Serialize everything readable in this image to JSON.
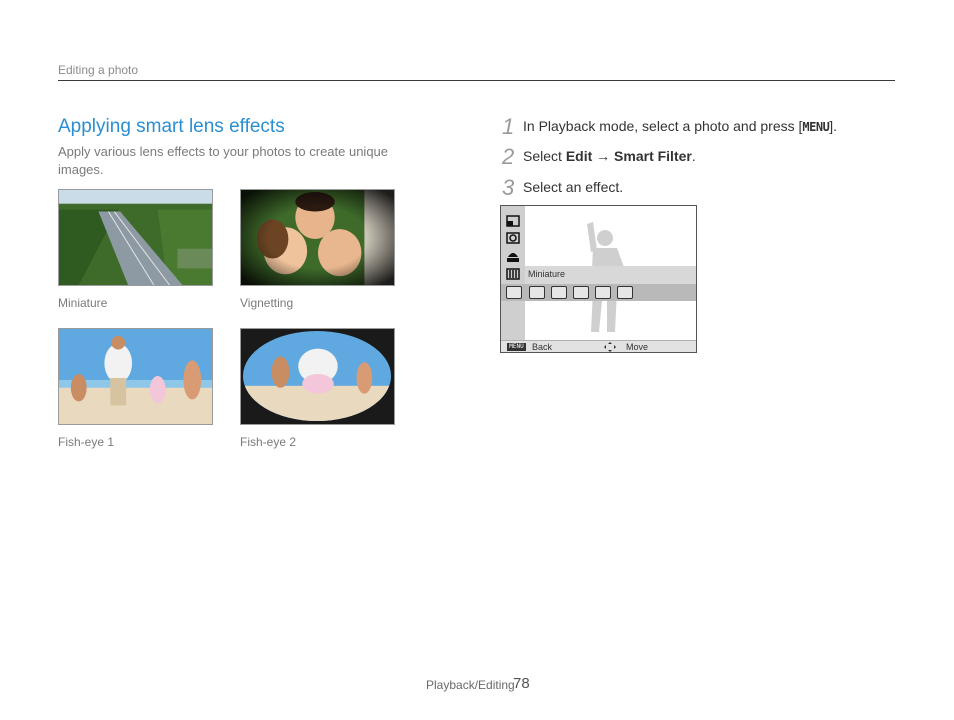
{
  "header": {
    "section": "Editing a photo"
  },
  "section": {
    "title": "Applying smart lens effects",
    "description": "Apply various lens effects to your photos to create unique images."
  },
  "examples": [
    {
      "caption": "Miniature"
    },
    {
      "caption": "Vignetting"
    },
    {
      "caption": "Fish-eye 1"
    },
    {
      "caption": "Fish-eye 2"
    }
  ],
  "steps": [
    {
      "num": "1",
      "before": "In Playback mode, select a photo and press [",
      "key": "MENU",
      "after": "]."
    },
    {
      "num": "2",
      "before": "Select ",
      "edit": "Edit",
      "arrow": " → ",
      "filter": "Smart Filter",
      "after": "."
    },
    {
      "num": "3",
      "text": "Select an effect."
    }
  ],
  "camera_screen": {
    "highlight_label": "Miniature",
    "menu_key": "MENU",
    "back_label": "Back",
    "move_label": "Move",
    "sidebar_icons": [
      "retouch-icon",
      "smart-filter-icon",
      "photo-style-icon",
      "miniature-icon"
    ],
    "effect_icons": [
      "effect-off-icon",
      "effect-off-2-icon",
      "miniature-effect-icon",
      "vignetting-icon",
      "fisheye-1-icon",
      "fisheye-2-icon"
    ]
  },
  "footer": {
    "section": "Playback/Editing",
    "page": "78"
  }
}
